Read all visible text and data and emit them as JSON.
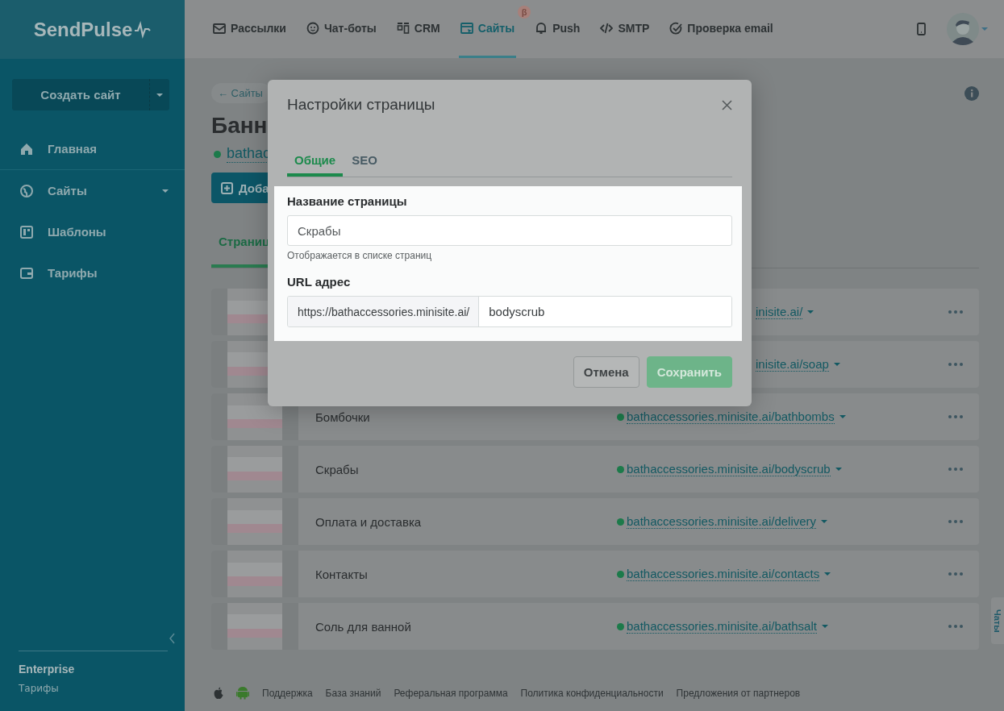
{
  "sidebar": {
    "logo": "SendPulse",
    "create_button": "Создать сайт",
    "items": [
      {
        "label": "Главная",
        "has_caret": false
      },
      {
        "label": "Сайты",
        "has_caret": true
      },
      {
        "label": "Шаблоны",
        "has_caret": false
      },
      {
        "label": "Тарифы",
        "has_caret": false
      }
    ],
    "plan": "Enterprise",
    "plan_link": "Тарифы"
  },
  "header": {
    "nav": [
      {
        "label": "Рассылки",
        "selected": false
      },
      {
        "label": "Чат-боты",
        "selected": false
      },
      {
        "label": "CRM",
        "selected": false
      },
      {
        "label": "Сайты",
        "selected": true,
        "badge": "β"
      },
      {
        "label": "Push",
        "selected": false
      },
      {
        "label": "SMTP",
        "selected": false
      },
      {
        "label": "Проверка email",
        "selected": false
      }
    ]
  },
  "page": {
    "breadcrumb": "← Сайты",
    "title": "Банн",
    "site_link": "bathac",
    "add_button": "Доба",
    "tab": "Страниц",
    "rows": [
      {
        "name": "",
        "link": "inisite.ai/"
      },
      {
        "name": "",
        "link": "inisite.ai/soap"
      },
      {
        "name": "Бомбочки",
        "link": "bathaccessories.minisite.ai/bathbombs"
      },
      {
        "name": "Скрабы",
        "link": "bathaccessories.minisite.ai/bodyscrub"
      },
      {
        "name": "Оплата и доставка",
        "link": "bathaccessories.minisite.ai/delivery"
      },
      {
        "name": "Контакты",
        "link": "bathaccessories.minisite.ai/contacts"
      },
      {
        "name": "Соль для ванной",
        "link": "bathaccessories.minisite.ai/bathsalt"
      }
    ],
    "chat_tab": "Чаты"
  },
  "modal": {
    "title": "Настройки страницы",
    "tabs": [
      {
        "label": "Общие",
        "selected": true
      },
      {
        "label": "SEO",
        "selected": false
      }
    ],
    "name_label": "Название страницы",
    "name_value": "Скрабы",
    "name_hint": "Отображается в списке страниц",
    "url_label": "URL адрес",
    "url_prefix": "https://bathaccessories.minisite.ai/",
    "url_value": "bodyscrub",
    "cancel": "Отмена",
    "save": "Сохранить"
  },
  "footer": {
    "links": [
      "Поддержка",
      "База знаний",
      "Реферальная программа",
      "Политика конфиденциальности",
      "Предложения от партнеров"
    ]
  }
}
